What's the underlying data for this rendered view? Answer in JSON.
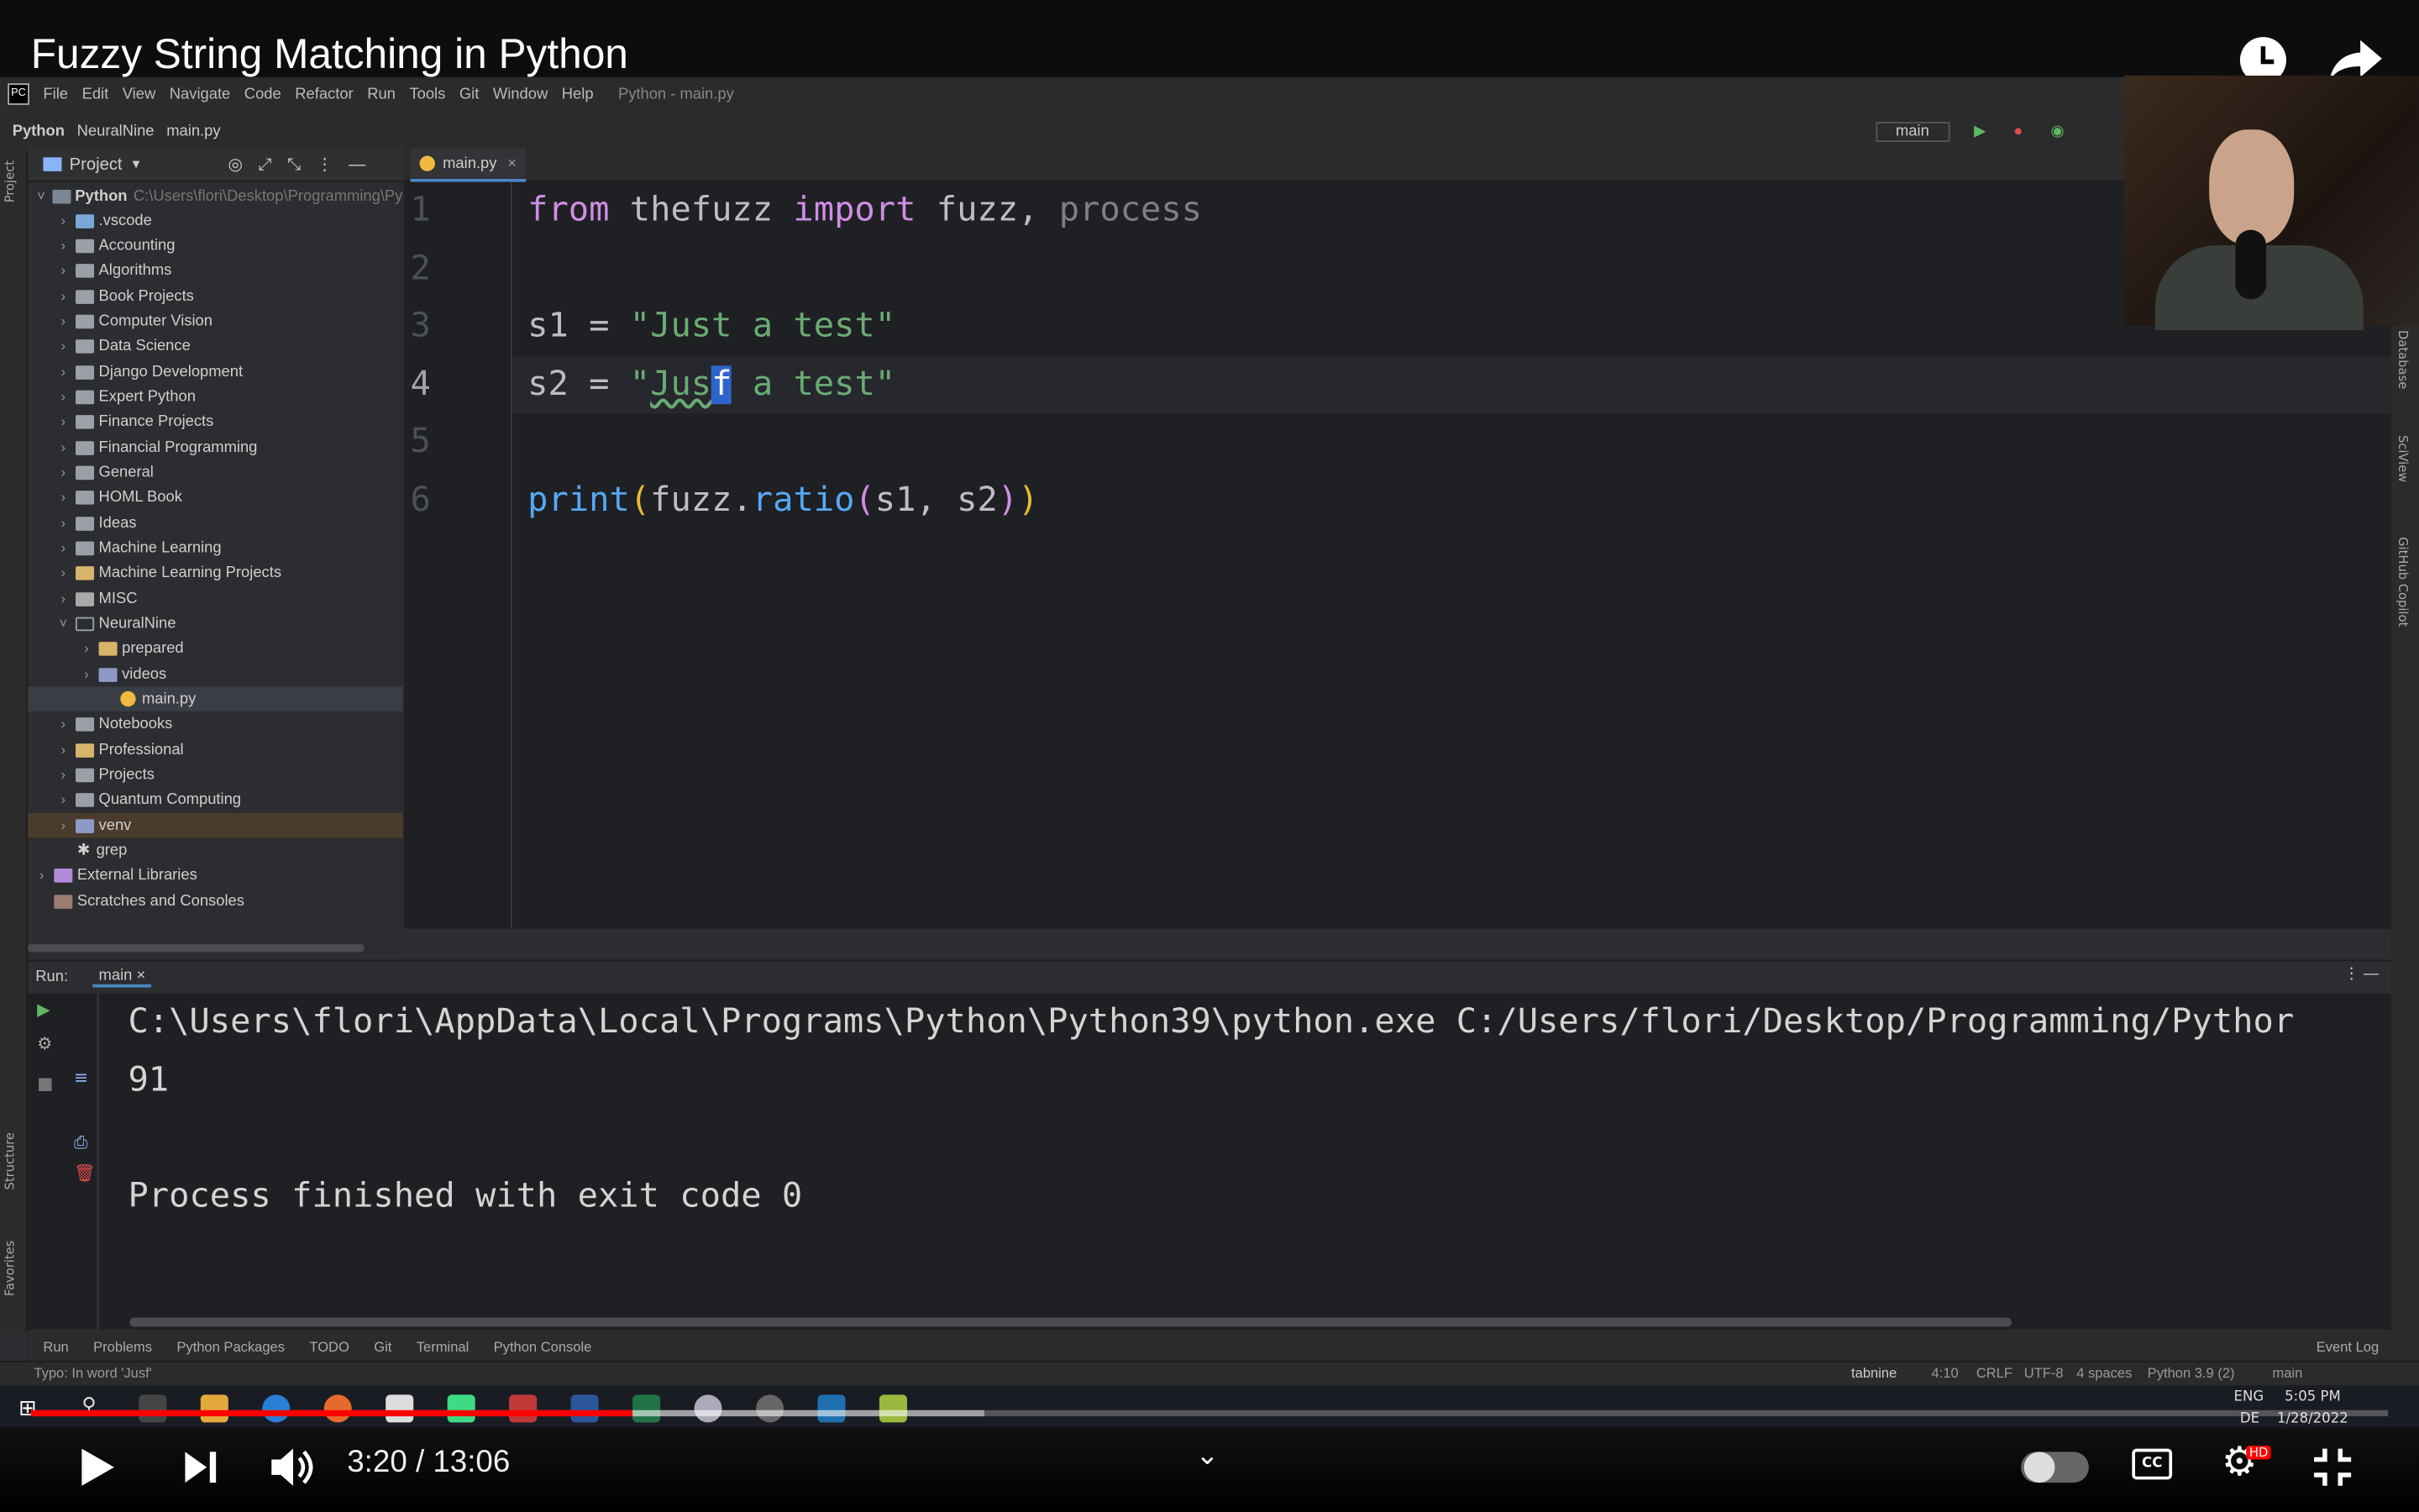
{
  "video": {
    "title": "Fuzzy String Matching in Python",
    "time": "3:20 / 13:06",
    "progress": 0.255
  },
  "menu": {
    "items": [
      "File",
      "Edit",
      "View",
      "Navigate",
      "Code",
      "Refactor",
      "Run",
      "Tools",
      "Git",
      "Window",
      "Help"
    ],
    "window_title": "Python - main.py"
  },
  "nav": {
    "crumbs": [
      "Python",
      "NeuralNine",
      "main.py"
    ],
    "run_config": "main"
  },
  "project": {
    "label": "Project",
    "root": "Python",
    "root_path": "C:\\Users\\flori\\Desktop\\Programming\\Py",
    "items": [
      ".vscode",
      "Accounting",
      "Algorithms",
      "Book Projects",
      "Computer Vision",
      "Data Science",
      "Django Development",
      "Expert Python",
      "Finance Projects",
      "Financial Programming",
      "General",
      "HOML Book",
      "Ideas",
      "Machine Learning",
      "Machine Learning Projects",
      "MISC",
      "NeuralNine",
      "prepared",
      "videos",
      "main.py",
      "Notebooks",
      "Professional",
      "Projects",
      "Quantum Computing",
      "venv",
      "grep",
      "External Libraries",
      "Scratches and Consoles"
    ]
  },
  "editor": {
    "tab": "main.py",
    "line_numbers": [
      "1",
      "2",
      "3",
      "4",
      "5",
      "6"
    ]
  },
  "run": {
    "label": "Run:",
    "config": "main",
    "cmd": "C:\\Users\\flori\\AppData\\Local\\Programs\\Python\\Python39\\python.exe C:/Users/flori/Desktop/Programming/Pythor",
    "result": "91",
    "exit": "Process finished with exit code 0"
  },
  "bottom_tabs": [
    "Run",
    "Problems",
    "Python Packages",
    "TODO",
    "Git",
    "Terminal",
    "Python Console"
  ],
  "event_log": "Event Log",
  "status": {
    "msg": "Typo: In word 'Jusf'",
    "plugin": "tabnine",
    "pos": "4:10",
    "eol": "CRLF",
    "enc": "UTF-8",
    "indent": "4 spaces",
    "interp": "Python 3.9 (2)",
    "branch": "main"
  },
  "tray": {
    "lang": "ENG",
    "kb": "DE",
    "clock": "5:05 PM",
    "date": "1/28/2022"
  },
  "right_strip": [
    "Database",
    "SciView",
    "GitHub Copilot"
  ],
  "left_strip": [
    "Project",
    "Structure",
    "Favorites"
  ]
}
